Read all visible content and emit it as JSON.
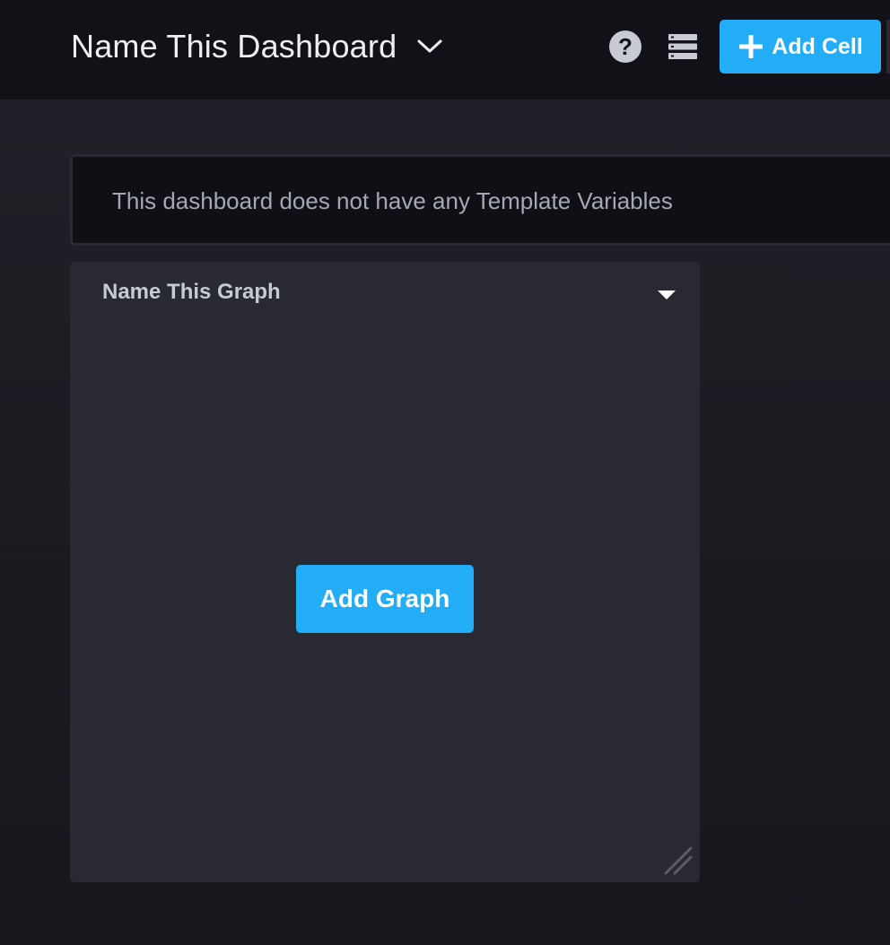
{
  "header": {
    "dashboard_name": "Name This Dashboard",
    "help_icon_glyph": "?",
    "add_cell_label": "Add Cell",
    "icons": [
      "chevron-down-icon",
      "help-icon",
      "template-variables-icon",
      "plus-icon"
    ]
  },
  "template_variables": {
    "empty_message": "This dashboard does not have any Template Variables"
  },
  "cell": {
    "title": "Name This Graph",
    "add_graph_label": "Add Graph",
    "icons": [
      "caret-down-icon",
      "resize-handle-icon"
    ]
  },
  "colors": {
    "accent": "#22adf6",
    "header_bg": "#111117",
    "page_bg": "#1b1b22",
    "cell_bg": "#292933",
    "tvar_bg": "#0f0f14"
  }
}
